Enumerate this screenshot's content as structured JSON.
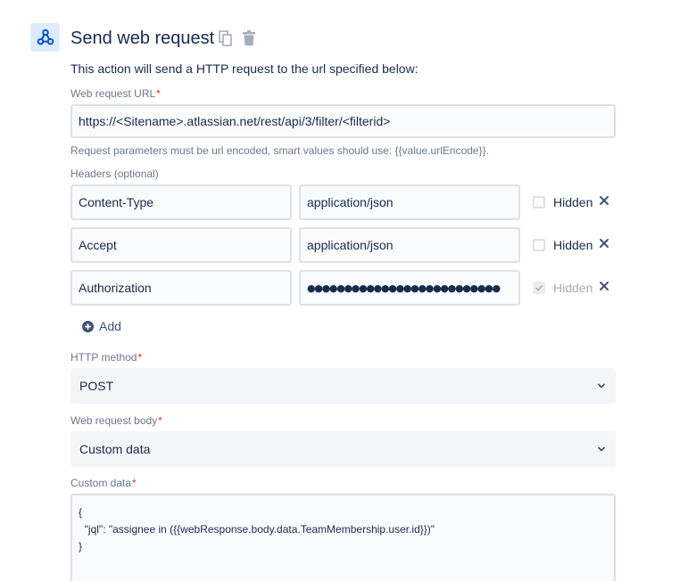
{
  "header": {
    "title": "Send web request",
    "icons": {
      "action": "webhook-icon",
      "copy": "copy-icon",
      "delete": "trash-icon"
    }
  },
  "description": "This action will send a HTTP request to the url specified below:",
  "url_field": {
    "label": "Web request URL",
    "required_mark": "*",
    "value": "https://<Sitename>.atlassian.net/rest/api/3/filter/<filterid>",
    "helper": "Request parameters must be url encoded, smart values should use: {{value.urlEncode}}."
  },
  "headers": {
    "label": "Headers (optional)",
    "hidden_label": "Hidden",
    "rows": [
      {
        "key": "Content-Type",
        "value": "application/json",
        "hidden": false
      },
      {
        "key": "Accept",
        "value": "application/json",
        "hidden": false
      },
      {
        "key": "Authorization",
        "value": "●●●●●●●●●●●●●●●●●●●●●●●●●●",
        "hidden": true
      }
    ],
    "add_label": "Add"
  },
  "http_method": {
    "label": "HTTP method",
    "required_mark": "*",
    "selected": "POST"
  },
  "body": {
    "label": "Web request body",
    "required_mark": "*",
    "selected": "Custom data"
  },
  "custom_data": {
    "label": "Custom data",
    "required_mark": "*",
    "value": "{\n  \"jql\": \"assignee in ({{webResponse.body.data.TeamMembership.user.id}})\"\n}"
  },
  "colors": {
    "accent": "#0052cc",
    "required": "#de350b",
    "icon_bg": "#deebff",
    "muted_text": "#6b778c"
  }
}
